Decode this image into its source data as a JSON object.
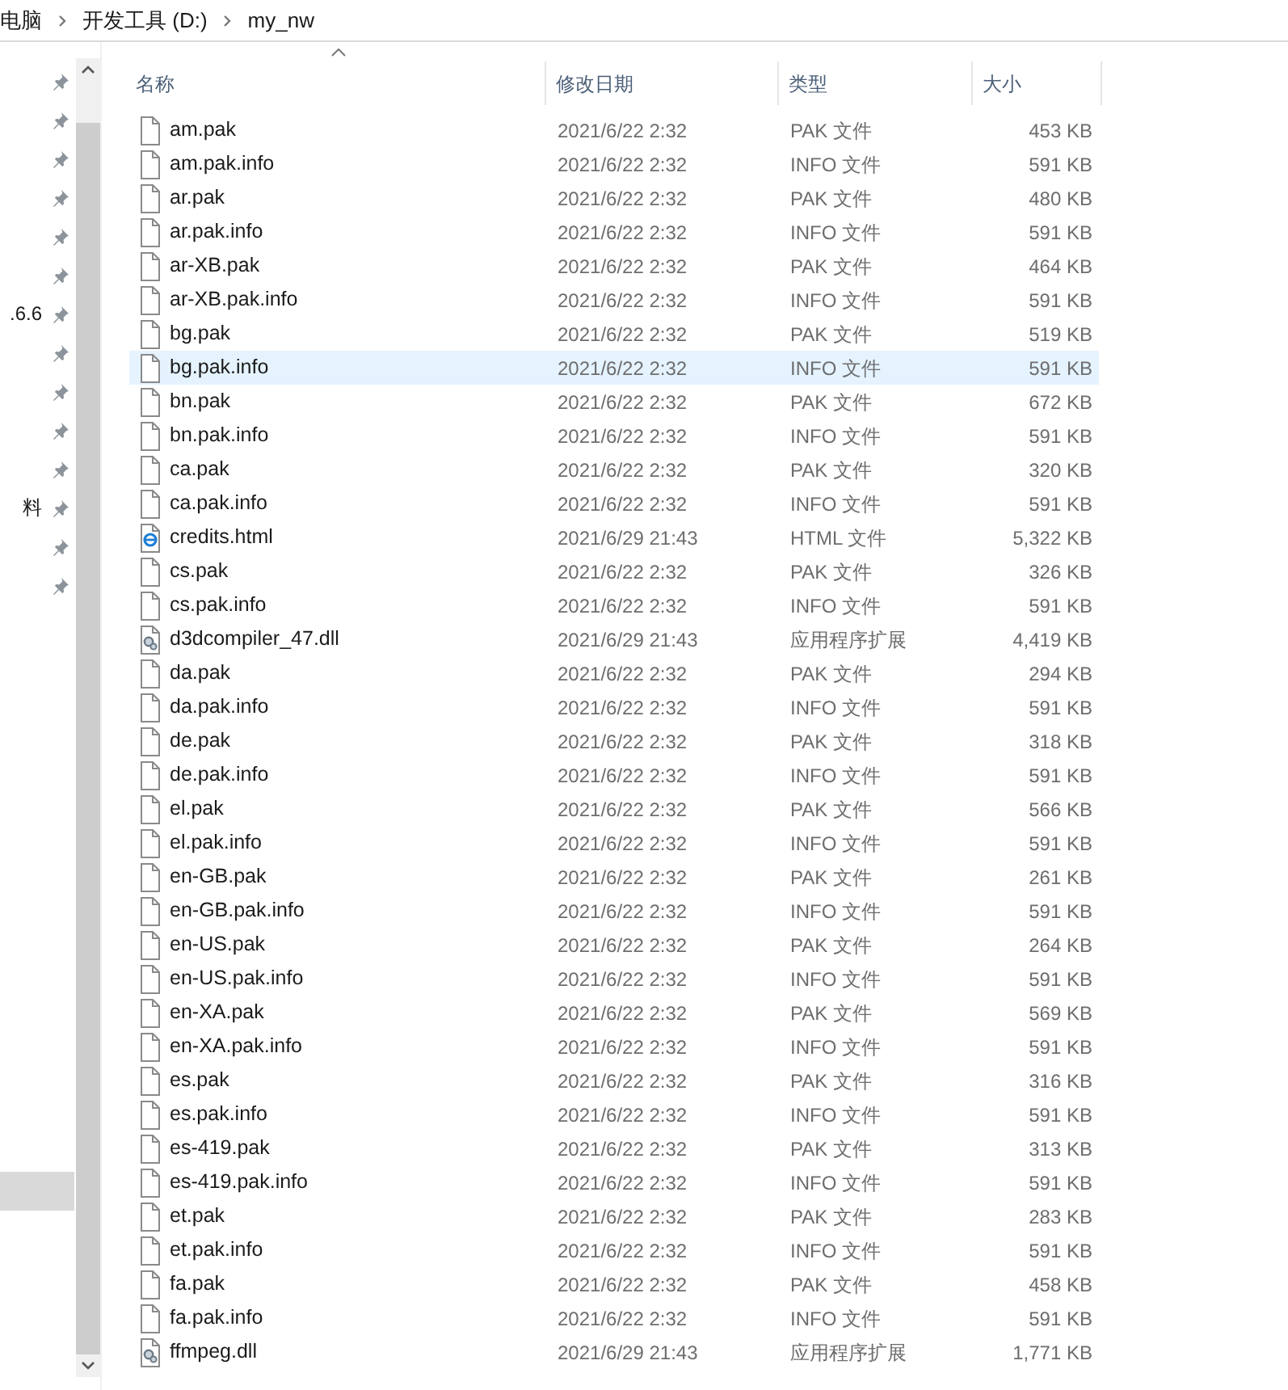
{
  "breadcrumb": [
    "电脑",
    "开发工具 (D:)",
    "my_nw"
  ],
  "nav": {
    "items": [
      {
        "pinned": true
      },
      {
        "pinned": true
      },
      {
        "pinned": true
      },
      {
        "pinned": true
      },
      {
        "pinned": true
      },
      {
        "pinned": true
      },
      {
        "label": ".6.6",
        "pinned": true
      },
      {
        "pinned": true
      },
      {
        "pinned": true
      },
      {
        "pinned": true
      },
      {
        "pinned": true
      },
      {
        "label": "料",
        "pinned": true
      },
      {
        "pinned": true
      },
      {
        "pinned": true
      }
    ]
  },
  "columns": [
    "名称",
    "修改日期",
    "类型",
    "大小"
  ],
  "rows": [
    {
      "name": "am.pak",
      "date": "2021/6/22 2:32",
      "type": "PAK 文件",
      "size": "453 KB",
      "kind": "file",
      "hovered": false
    },
    {
      "name": "am.pak.info",
      "date": "2021/6/22 2:32",
      "type": "INFO 文件",
      "size": "591 KB",
      "kind": "file",
      "hovered": false
    },
    {
      "name": "ar.pak",
      "date": "2021/6/22 2:32",
      "type": "PAK 文件",
      "size": "480 KB",
      "kind": "file",
      "hovered": false
    },
    {
      "name": "ar.pak.info",
      "date": "2021/6/22 2:32",
      "type": "INFO 文件",
      "size": "591 KB",
      "kind": "file",
      "hovered": false
    },
    {
      "name": "ar-XB.pak",
      "date": "2021/6/22 2:32",
      "type": "PAK 文件",
      "size": "464 KB",
      "kind": "file",
      "hovered": false
    },
    {
      "name": "ar-XB.pak.info",
      "date": "2021/6/22 2:32",
      "type": "INFO 文件",
      "size": "591 KB",
      "kind": "file",
      "hovered": false
    },
    {
      "name": "bg.pak",
      "date": "2021/6/22 2:32",
      "type": "PAK 文件",
      "size": "519 KB",
      "kind": "file",
      "hovered": false
    },
    {
      "name": "bg.pak.info",
      "date": "2021/6/22 2:32",
      "type": "INFO 文件",
      "size": "591 KB",
      "kind": "file",
      "hovered": true
    },
    {
      "name": "bn.pak",
      "date": "2021/6/22 2:32",
      "type": "PAK 文件",
      "size": "672 KB",
      "kind": "file",
      "hovered": false
    },
    {
      "name": "bn.pak.info",
      "date": "2021/6/22 2:32",
      "type": "INFO 文件",
      "size": "591 KB",
      "kind": "file",
      "hovered": false
    },
    {
      "name": "ca.pak",
      "date": "2021/6/22 2:32",
      "type": "PAK 文件",
      "size": "320 KB",
      "kind": "file",
      "hovered": false
    },
    {
      "name": "ca.pak.info",
      "date": "2021/6/22 2:32",
      "type": "INFO 文件",
      "size": "591 KB",
      "kind": "file",
      "hovered": false
    },
    {
      "name": "credits.html",
      "date": "2021/6/29 21:43",
      "type": "HTML 文件",
      "size": "5,322 KB",
      "kind": "html",
      "hovered": false
    },
    {
      "name": "cs.pak",
      "date": "2021/6/22 2:32",
      "type": "PAK 文件",
      "size": "326 KB",
      "kind": "file",
      "hovered": false
    },
    {
      "name": "cs.pak.info",
      "date": "2021/6/22 2:32",
      "type": "INFO 文件",
      "size": "591 KB",
      "kind": "file",
      "hovered": false
    },
    {
      "name": "d3dcompiler_47.dll",
      "date": "2021/6/29 21:43",
      "type": "应用程序扩展",
      "size": "4,419 KB",
      "kind": "dll",
      "hovered": false
    },
    {
      "name": "da.pak",
      "date": "2021/6/22 2:32",
      "type": "PAK 文件",
      "size": "294 KB",
      "kind": "file",
      "hovered": false
    },
    {
      "name": "da.pak.info",
      "date": "2021/6/22 2:32",
      "type": "INFO 文件",
      "size": "591 KB",
      "kind": "file",
      "hovered": false
    },
    {
      "name": "de.pak",
      "date": "2021/6/22 2:32",
      "type": "PAK 文件",
      "size": "318 KB",
      "kind": "file",
      "hovered": false
    },
    {
      "name": "de.pak.info",
      "date": "2021/6/22 2:32",
      "type": "INFO 文件",
      "size": "591 KB",
      "kind": "file",
      "hovered": false
    },
    {
      "name": "el.pak",
      "date": "2021/6/22 2:32",
      "type": "PAK 文件",
      "size": "566 KB",
      "kind": "file",
      "hovered": false
    },
    {
      "name": "el.pak.info",
      "date": "2021/6/22 2:32",
      "type": "INFO 文件",
      "size": "591 KB",
      "kind": "file",
      "hovered": false
    },
    {
      "name": "en-GB.pak",
      "date": "2021/6/22 2:32",
      "type": "PAK 文件",
      "size": "261 KB",
      "kind": "file",
      "hovered": false
    },
    {
      "name": "en-GB.pak.info",
      "date": "2021/6/22 2:32",
      "type": "INFO 文件",
      "size": "591 KB",
      "kind": "file",
      "hovered": false
    },
    {
      "name": "en-US.pak",
      "date": "2021/6/22 2:32",
      "type": "PAK 文件",
      "size": "264 KB",
      "kind": "file",
      "hovered": false
    },
    {
      "name": "en-US.pak.info",
      "date": "2021/6/22 2:32",
      "type": "INFO 文件",
      "size": "591 KB",
      "kind": "file",
      "hovered": false
    },
    {
      "name": "en-XA.pak",
      "date": "2021/6/22 2:32",
      "type": "PAK 文件",
      "size": "569 KB",
      "kind": "file",
      "hovered": false
    },
    {
      "name": "en-XA.pak.info",
      "date": "2021/6/22 2:32",
      "type": "INFO 文件",
      "size": "591 KB",
      "kind": "file",
      "hovered": false
    },
    {
      "name": "es.pak",
      "date": "2021/6/22 2:32",
      "type": "PAK 文件",
      "size": "316 KB",
      "kind": "file",
      "hovered": false
    },
    {
      "name": "es.pak.info",
      "date": "2021/6/22 2:32",
      "type": "INFO 文件",
      "size": "591 KB",
      "kind": "file",
      "hovered": false
    },
    {
      "name": "es-419.pak",
      "date": "2021/6/22 2:32",
      "type": "PAK 文件",
      "size": "313 KB",
      "kind": "file",
      "hovered": false
    },
    {
      "name": "es-419.pak.info",
      "date": "2021/6/22 2:32",
      "type": "INFO 文件",
      "size": "591 KB",
      "kind": "file",
      "hovered": false
    },
    {
      "name": "et.pak",
      "date": "2021/6/22 2:32",
      "type": "PAK 文件",
      "size": "283 KB",
      "kind": "file",
      "hovered": false
    },
    {
      "name": "et.pak.info",
      "date": "2021/6/22 2:32",
      "type": "INFO 文件",
      "size": "591 KB",
      "kind": "file",
      "hovered": false
    },
    {
      "name": "fa.pak",
      "date": "2021/6/22 2:32",
      "type": "PAK 文件",
      "size": "458 KB",
      "kind": "file",
      "hovered": false
    },
    {
      "name": "fa.pak.info",
      "date": "2021/6/22 2:32",
      "type": "INFO 文件",
      "size": "591 KB",
      "kind": "file",
      "hovered": false
    },
    {
      "name": "ffmpeg.dll",
      "date": "2021/6/29 21:43",
      "type": "应用程序扩展",
      "size": "1,771 KB",
      "kind": "dll",
      "hovered": false
    }
  ]
}
